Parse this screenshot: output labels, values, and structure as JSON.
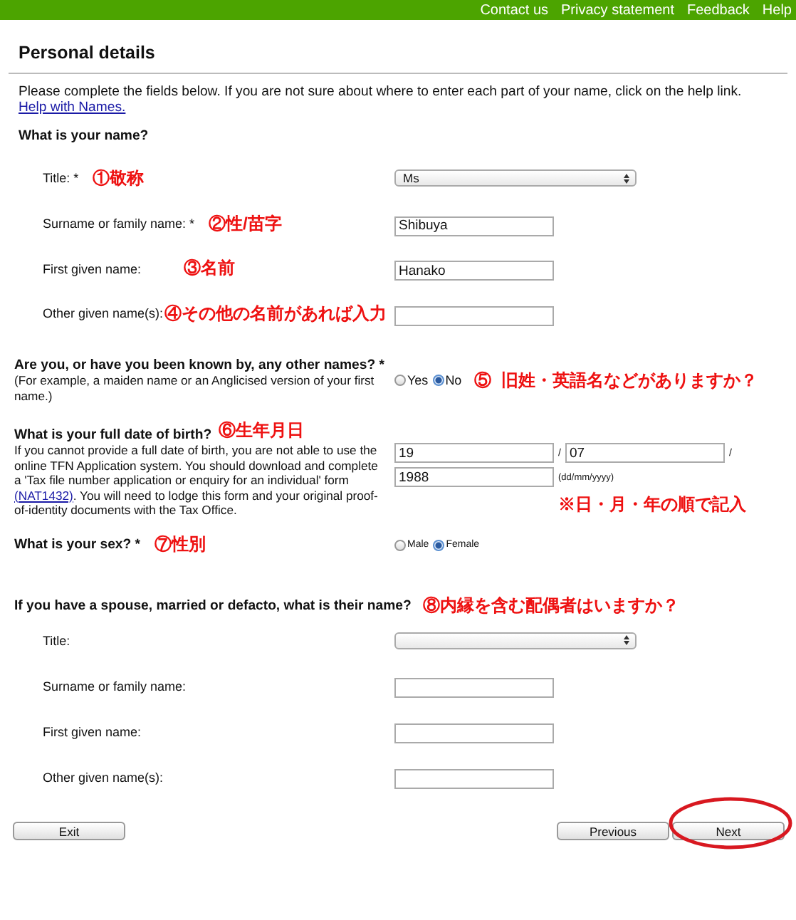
{
  "top_links": [
    "Contact us",
    "Privacy statement",
    "Feedback",
    "Help"
  ],
  "page_title": "Personal details",
  "intro": {
    "text": "Please complete the fields below. If you are not sure about where to enter each part of your name, click on the help link.",
    "link": "Help with Names."
  },
  "name_section": {
    "heading": "What is your name?",
    "fields": [
      {
        "kind": "select",
        "label": "Title: *",
        "value": "Ms",
        "note": "①敬称"
      },
      {
        "kind": "text",
        "label": "Surname or family name: *",
        "value": "Shibuya",
        "note": "②性/苗字"
      },
      {
        "kind": "text",
        "label": "First given name:",
        "value": "Hanako",
        "note": "③名前"
      },
      {
        "kind": "text",
        "label": "Other given name(s):",
        "note": "④その他の名前があれば入力"
      }
    ]
  },
  "other_names": {
    "question": "Are you, or have you been known by, any other names? *",
    "hint": "(For example, a maiden name or an Anglicised version of your first name.)",
    "options": [
      {
        "label": "Yes",
        "selected": false
      },
      {
        "label": "No",
        "selected": true
      }
    ],
    "note": "⑤  旧姓・英語名などがありますか？"
  },
  "birth": {
    "question": "What is your full date of birth?",
    "note": "⑥生年月日",
    "text_before": "If you cannot provide a full date of birth, you are not able to use the online TFN Application system. You should download and complete a 'Tax file number application or enquiry for an individual' form ",
    "link": "(NAT1432)",
    "text_after": ". You will need to lodge this form and your original proof-of-identity documents with the Tax Office.",
    "day": "19",
    "sep1": "/",
    "month": "07",
    "sep2": "/",
    "year": "1988",
    "format": "(dd/mm/yyyy)",
    "order_note": "※日・月・年の順で記入"
  },
  "sex": {
    "question": "What is your sex? *",
    "note": "⑦性別",
    "options": [
      {
        "label": "Male",
        "selected": false
      },
      {
        "label": "Female",
        "selected": true
      }
    ]
  },
  "spouse": {
    "heading": "If you have a spouse, married or defacto, what is their name?",
    "note": "⑧内縁を含む配偶者はいますか？",
    "fields": [
      {
        "kind": "select",
        "label": "Title:"
      },
      {
        "kind": "text",
        "label": "Surname or family name:"
      },
      {
        "kind": "text",
        "label": "First given name:"
      },
      {
        "kind": "text",
        "label": "Other given name(s):"
      }
    ]
  },
  "buttons": [
    {
      "label": "Exit",
      "highlighted": false
    },
    {
      "label": "Previous",
      "highlighted": false
    },
    {
      "label": "Next",
      "highlighted": true
    }
  ]
}
